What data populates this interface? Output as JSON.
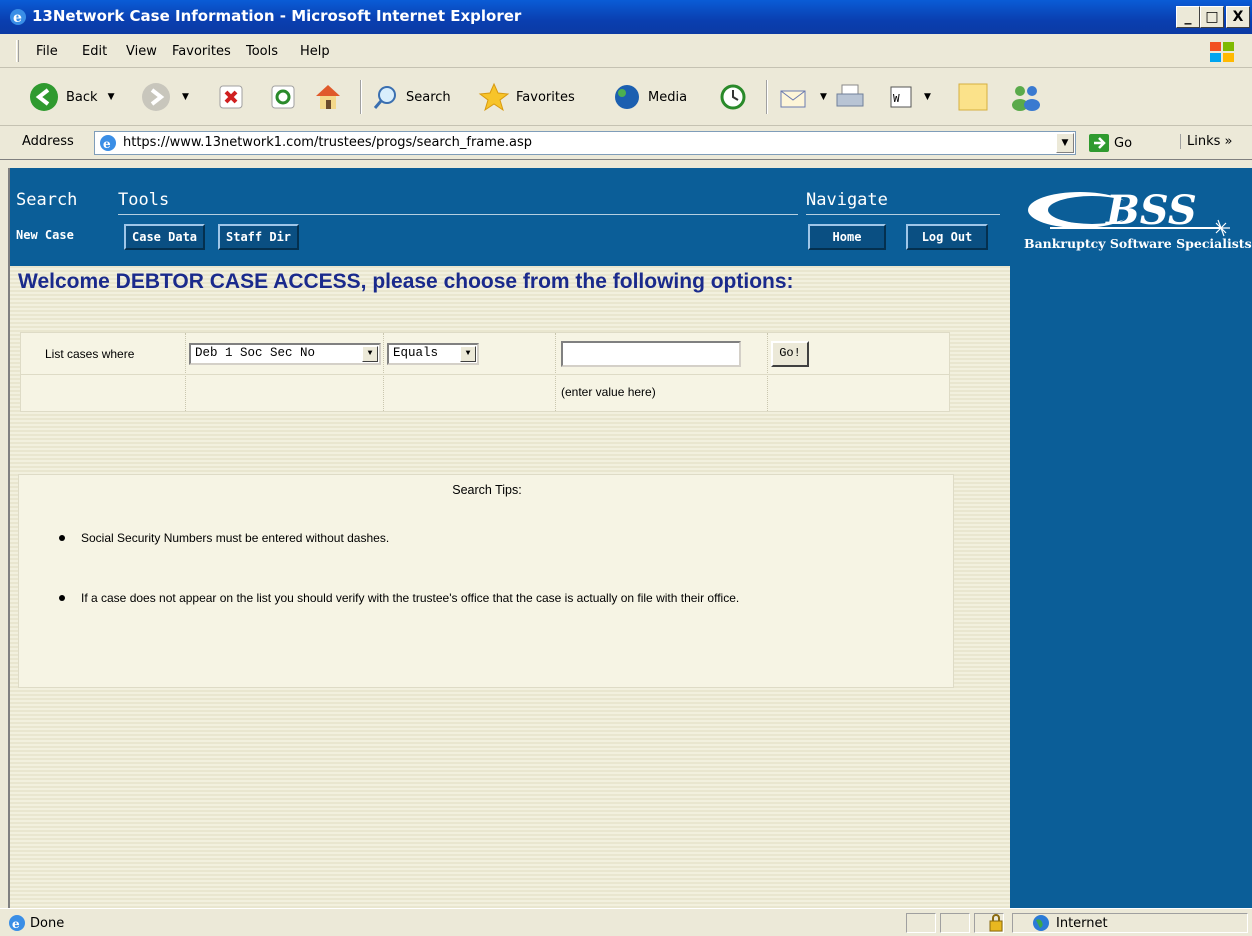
{
  "window": {
    "title": "13Network Case Information - Microsoft Internet Explorer",
    "controls": [
      "_",
      "□",
      "X"
    ]
  },
  "menu": [
    "File",
    "Edit",
    "View",
    "Favorites",
    "Tools",
    "Help"
  ],
  "toolbar": {
    "back_label": "Back",
    "search_label": "Search",
    "favorites_label": "Favorites",
    "media_label": "Media"
  },
  "address": {
    "label": "Address",
    "url": "https://www.13network1.com/trustees/progs/search_frame.asp",
    "go_label": "Go",
    "links_label": "Links"
  },
  "nav": {
    "search_label": "Search",
    "tools_label": "Tools",
    "navigate_label": "Navigate",
    "new_case": "New Case",
    "case_data": "Case Data",
    "staff_dir": "Staff Dir",
    "home": "Home",
    "log_out": "Log Out"
  },
  "brand": {
    "logo_text": "BSS",
    "tagline": "Bankruptcy Software Specialists"
  },
  "page": {
    "welcome": "Welcome DEBTOR CASE ACCESS, please choose from the following options:"
  },
  "search": {
    "list_label": "List cases where",
    "field_selected": "Deb 1 Soc Sec No",
    "operator_selected": "Equals",
    "value": "",
    "go_label": "Go!",
    "hint": "(enter value here)"
  },
  "tips": {
    "title": "Search Tips:",
    "items": [
      "Social Security Numbers must be entered without dashes.",
      "If a case does not appear on the list you should verify with the trustee's office that the case is actually on file with their office."
    ]
  },
  "status": {
    "text": "Done",
    "zone": "Internet"
  },
  "colors": {
    "titlebar": "#0a3fb0",
    "nav_panel": "#0b5e98",
    "welcome_text": "#1a2a8c",
    "content_bg": "#e9e6cf"
  }
}
